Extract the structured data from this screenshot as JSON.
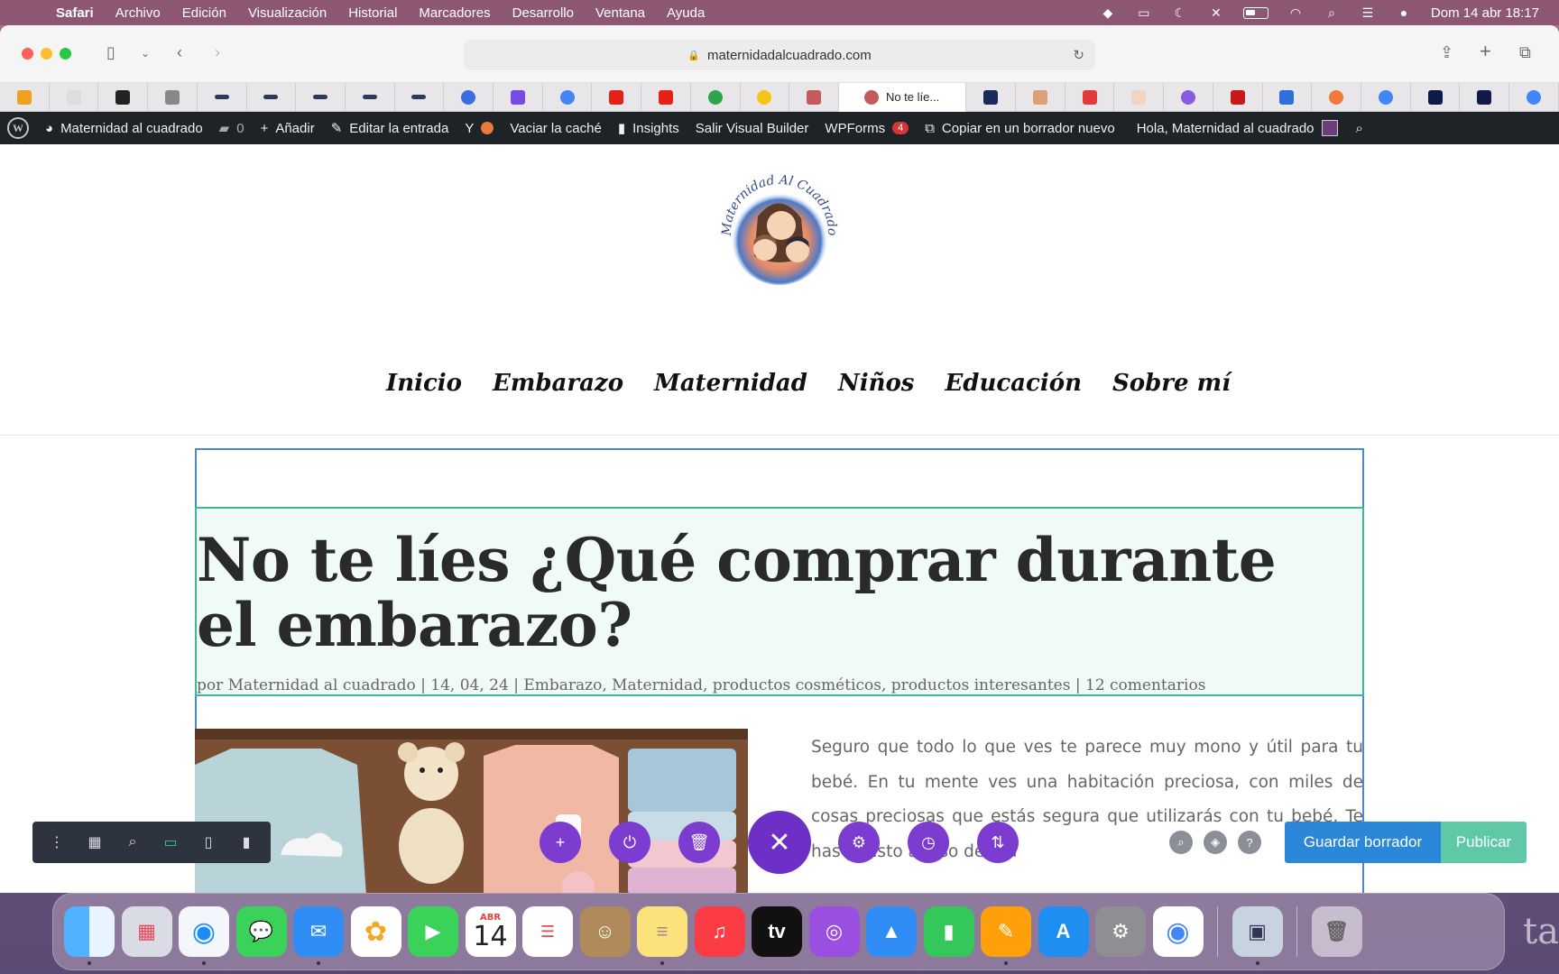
{
  "menubar": {
    "app": "Safari",
    "items": [
      "Archivo",
      "Edición",
      "Visualización",
      "Historial",
      "Marcadores",
      "Desarrollo",
      "Ventana",
      "Ayuda"
    ],
    "clock": "Dom 14 abr 18:17"
  },
  "browser": {
    "url": "maternidadalcuadrado.com",
    "active_tab": "No te líe..."
  },
  "wpbar": {
    "site": "Maternidad al cuadrado",
    "comments_count": "0",
    "add": "Añadir",
    "edit_post": "Editar la entrada",
    "clear_cache": "Vaciar la caché",
    "insights": "Insights",
    "exit_builder": "Salir Visual Builder",
    "wpforms": "WPForms",
    "wpforms_badge": "4",
    "copy_draft": "Copiar en un borrador nuevo",
    "greeting": "Hola, Maternidad al cuadrado"
  },
  "site": {
    "logo_text": "Maternidad Al Cuadrado",
    "nav": [
      "Inicio",
      "Embarazo",
      "Maternidad",
      "Niños",
      "Educación",
      "Sobre mí"
    ]
  },
  "post": {
    "title": "No te líes ¿Qué comprar durante el embarazo?",
    "meta": "por Maternidad al cuadrado | 14, 04, 24 | Embarazo, Maternidad, productos cosméticos, productos interesantes | 12 comentarios",
    "body": "Seguro que todo lo que ves te parece muy mono y útil para tu bebé. En tu mente ves una habitación preciosa, con miles de cosas preciosas que estás segura  que utilizarás con tu bebé.  Te has puesto abuso de tod"
  },
  "builder": {
    "save_draft": "Guardar borrador",
    "publish": "Publicar"
  },
  "dock": {
    "calendar_month": "ABR",
    "calendar_day": "14"
  },
  "colors": {
    "wp_admin": "#1d2327",
    "divi_purple": "#7b3ccf",
    "save_blue": "#2b87da",
    "publish_green": "#5fc9a7",
    "section_blue": "#4a88d4",
    "row_green": "#3fb89a"
  }
}
